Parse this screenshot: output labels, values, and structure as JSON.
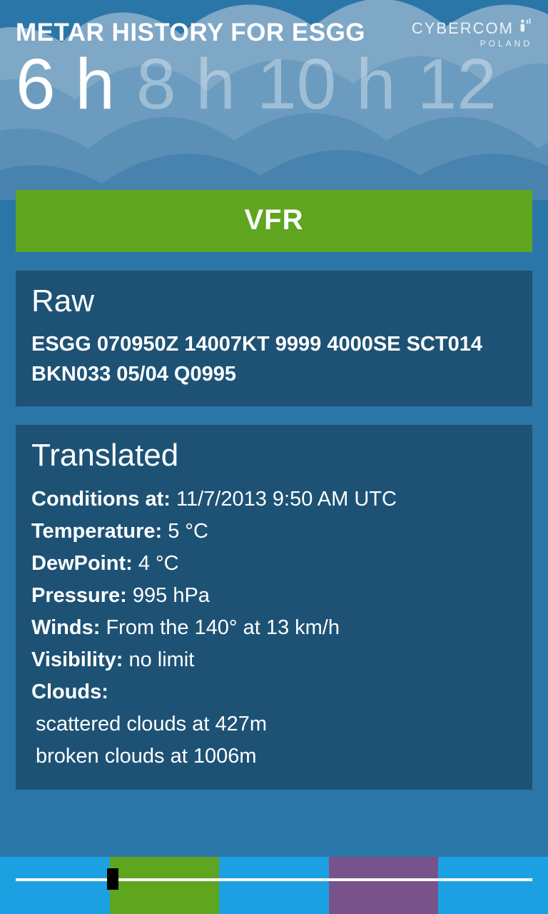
{
  "header": {
    "title": "METAR HISTORY FOR ESGG",
    "brand_name": "CYBERCOM",
    "brand_sub": "POLAND"
  },
  "pivot": {
    "items": [
      "6 h",
      "8 h",
      "10 h",
      "12"
    ],
    "active_index": 0
  },
  "banner": {
    "label": "VFR"
  },
  "raw": {
    "heading": "Raw",
    "text": "ESGG 070950Z 14007KT 9999 4000SE SCT014 BKN033 05/04 Q0995"
  },
  "translated": {
    "heading": "Translated",
    "fields": {
      "conditions_label": "Conditions at:",
      "conditions_value": "11/7/2013 9:50 AM  UTC",
      "temperature_label": "Temperature:",
      "temperature_value": " 5 °C",
      "dewpoint_label": "DewPoint:",
      "dewpoint_value": " 4 °C",
      "pressure_label": "Pressure:",
      "pressure_value": " 995 hPa",
      "winds_label": "Winds:",
      "winds_value": " From the  140°  at  13 km/h",
      "visibility_label": "Visibility:",
      "visibility_value": " no limit",
      "clouds_label": "Clouds:",
      "clouds_lines": [
        " scattered clouds at 427m",
        " broken clouds at 1006m"
      ]
    }
  },
  "colors": {
    "bg": "#2b76a8",
    "card": "#1d5275",
    "banner": "#5fa51f",
    "tile_accent": "#1ba1e2",
    "tile_purple": "#78538b"
  }
}
